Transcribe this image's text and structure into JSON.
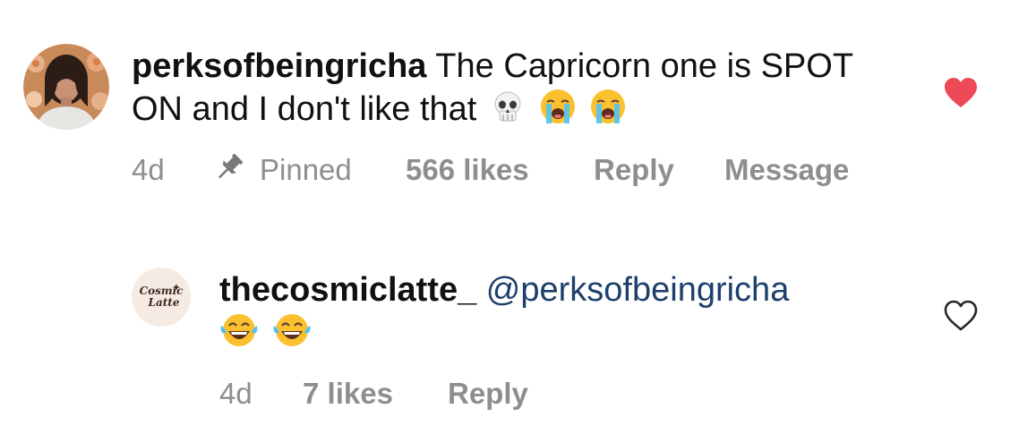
{
  "comments": [
    {
      "username": "perksofbeingricha",
      "text": "The Capricorn one is SPOT ON and I don't like that",
      "emojis": [
        "skull",
        "loudly-crying-face",
        "loudly-crying-face"
      ],
      "time": "4d",
      "pinned_label": "Pinned",
      "likes": "566 likes",
      "reply_label": "Reply",
      "message_label": "Message",
      "liked": true,
      "heart_color": "#ed4956"
    },
    {
      "username": "thecosmiclatte_",
      "mention": "@perksofbeingricha",
      "emojis": [
        "face-with-tears-of-joy",
        "face-with-tears-of-joy"
      ],
      "time": "4d",
      "likes": "7 likes",
      "reply_label": "Reply",
      "liked": false,
      "avatar_logo_text": "Cosmic Latte"
    }
  ],
  "colors": {
    "text": "#111111",
    "meta": "#8e8e8e",
    "mention": "#1d3f6b",
    "liked_heart": "#ed4956",
    "unliked_heart": "#262626"
  }
}
